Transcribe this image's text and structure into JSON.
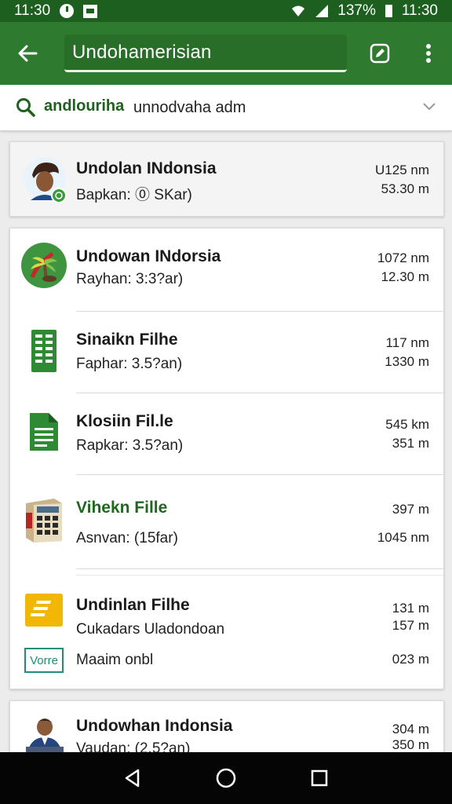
{
  "status_bar": {
    "time_left": "11:30",
    "battery": "137%",
    "time_right": "11:30"
  },
  "app_bar": {
    "title": "Undohamerisian"
  },
  "search": {
    "chip": "andlouriha",
    "value": "unnodvaha adm"
  },
  "items": [
    {
      "title": "Undolan INdonsia",
      "subtitle": "Bapkan: ⓪ SKar)",
      "meta1": "U125 nm",
      "meta2": "53.30 m",
      "icon": "avatar-man"
    },
    {
      "title": "Undowan INdorsia",
      "subtitle": "Rayhan: 3:3?ar)",
      "meta1": "1072 nm",
      "meta2": "12.30 m",
      "icon": "palm-logo"
    },
    {
      "title": "Sinaikn Filhe",
      "subtitle": "Faphar: 3.5?an)",
      "meta1": "117 nm",
      "meta2": "1330 m",
      "icon": "spreadsheet-icon"
    },
    {
      "title": "Klosiin Fil.le",
      "subtitle": "Rapkar: 3.5?an)",
      "meta1": "545 km",
      "meta2": "351 m",
      "icon": "document-icon"
    },
    {
      "title": "Vihekn Fille",
      "subtitle": "Asnvan: (15far)",
      "meta1": "397 m",
      "meta2": "1045 nm",
      "icon": "calculator-thumb"
    },
    {
      "title": "Undinlan Filhe",
      "subtitle": "Cukadars Uladondoan",
      "meta1": "131 m",
      "meta2": "157 m",
      "extra_label": "Vorre",
      "extra_text": "Maaim onbl",
      "extra_meta": "023 m",
      "icon": "folder-yellow"
    },
    {
      "title": "Undowhan Indonsia",
      "subtitle": "Vaudan: (2.5?an)",
      "meta1": "304 m",
      "meta2": "350 m",
      "icon": "avatar-person"
    }
  ]
}
